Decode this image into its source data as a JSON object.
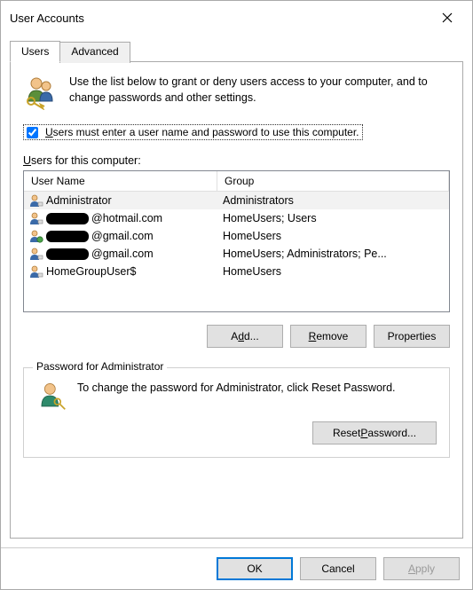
{
  "title": "User Accounts",
  "tabs": {
    "users": "Users",
    "advanced": "Advanced"
  },
  "intro": "Use the list below to grant or deny users access to your computer, and to change passwords and other settings.",
  "checkbox": {
    "checked": true,
    "prefix": "U",
    "rest": "sers must enter a user name and password to use this computer."
  },
  "list_label_prefix": "U",
  "list_label_rest": "sers for this computer:",
  "columns": {
    "name": "User Name",
    "group": "Group"
  },
  "rows": [
    {
      "name": "Administrator",
      "group": "Administrators",
      "redacted": false,
      "selected": true,
      "icon": "user"
    },
    {
      "name": "@hotmail.com",
      "group": "HomeUsers; Users",
      "redacted": true,
      "redact_w": 48,
      "selected": false,
      "icon": "user"
    },
    {
      "name": "@gmail.com",
      "group": "HomeUsers",
      "redacted": true,
      "redact_w": 48,
      "selected": false,
      "icon": "user-globe"
    },
    {
      "name": "@gmail.com",
      "group": "HomeUsers; Administrators; Pe...",
      "redacted": true,
      "redact_w": 48,
      "selected": false,
      "icon": "user"
    },
    {
      "name": "HomeGroupUser$",
      "group": "HomeUsers",
      "redacted": false,
      "selected": false,
      "icon": "user"
    }
  ],
  "buttons": {
    "add_u": "d",
    "add_pre": "A",
    "add_post": "d...",
    "remove_u": "R",
    "remove_post": "emove",
    "props_u": "",
    "props": "Properties",
    "reset_pre": "Reset ",
    "reset_u": "P",
    "reset_post": "assword...",
    "ok": "OK",
    "cancel": "Cancel",
    "apply_u": "A",
    "apply_post": "pply"
  },
  "pw_group": {
    "legend": "Password for Administrator",
    "text": "To change the password for Administrator, click Reset Password."
  }
}
